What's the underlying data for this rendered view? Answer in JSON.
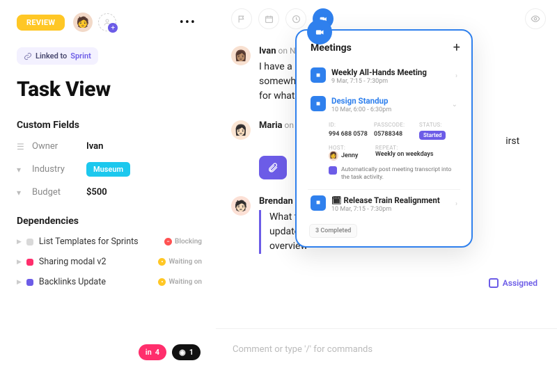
{
  "left": {
    "review": "REVIEW",
    "linked_prefix": "Linked to ",
    "linked_target": "Sprint",
    "title": "Task View",
    "custom_fields_heading": "Custom Fields",
    "owner_label": "Owner",
    "owner_value": "Ivan",
    "industry_label": "Industry",
    "industry_value": "Museum",
    "budget_label": "Budget",
    "budget_value": "$500",
    "dependencies_heading": "Dependencies",
    "deps": [
      {
        "title": "List Templates for Sprints",
        "status": "Blocking",
        "color": "#d9d9d9",
        "kind": "blocking"
      },
      {
        "title": "Sharing modal v2",
        "status": "Waiting on",
        "color": "#FF2E6C",
        "kind": "waiting"
      },
      {
        "title": "Backlinks Update",
        "status": "Waiting on",
        "color": "#6C5CE7",
        "kind": "waiting"
      }
    ],
    "badge1_count": "4",
    "badge2_count": "1"
  },
  "feed": {
    "items": [
      {
        "name": "Ivan",
        "meta": " on N",
        "body_1": "I have a ",
        "body_2": " somewhere",
        "body_3": "for what"
      },
      {
        "name": "Maria",
        "meta": " on",
        "body_1": "irst"
      },
      {
        "name": "Brendan",
        "meta": "",
        "body_1": "What tin",
        "body_2": " update",
        "body_3": "overview"
      }
    ],
    "assigned": "Assigned",
    "comment_placeholder": "Comment or type '/' for commands"
  },
  "pop": {
    "title": "Meetings",
    "m1_title": "Weekly All-Hands Meeting",
    "m1_sub": "9 Mar, 7:15 - 7:30pm",
    "m2_title": "Design Standup",
    "m2_sub": "10 Mar, 6:00 - 6:30pm",
    "id_label": "ID:",
    "id_value": "994 688 0578",
    "pass_label": "PASSCODE:",
    "pass_value": "05788348",
    "status_label": "STATUS:",
    "status_value": "Started",
    "host_label": "HOST:",
    "host_value": "Jenny",
    "repeat_label": "REPEAT:",
    "repeat_value": "Weekly on weekdays",
    "auto_text": "Automatically post meeting transcript into the task activity.",
    "m3_title": "🗓 Release Train Realignment",
    "m3_sub": "10 Mar, 7:15 - 7:30pm",
    "completed": "3 Completed"
  }
}
